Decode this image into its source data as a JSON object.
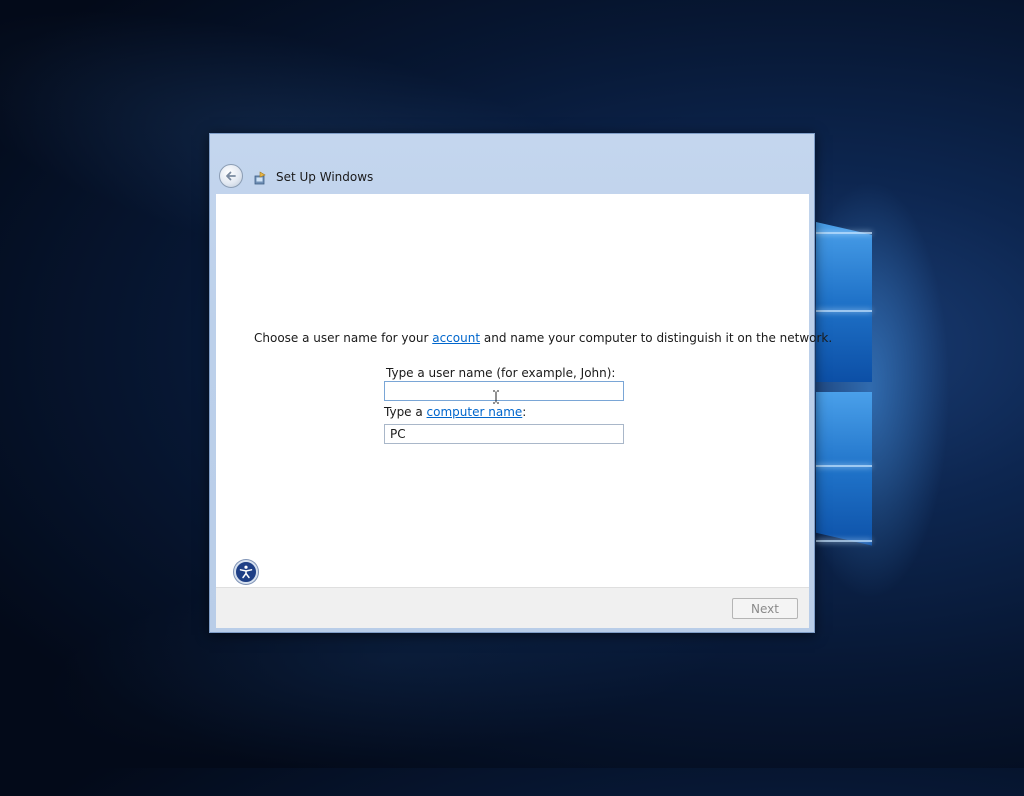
{
  "window": {
    "title": "Set Up Windows",
    "back_icon": "back-arrow-icon",
    "title_icon": "setup-icon"
  },
  "main": {
    "prompt_before": "Choose a user name for your ",
    "prompt_link": "account",
    "prompt_after": " and name your computer to distinguish it on the network.",
    "username_label": "Type a user name (for example, John):",
    "username_value": "",
    "computer_label_before": "Type a ",
    "computer_label_link": "computer name",
    "computer_label_after": ":",
    "computer_name_value": "PC"
  },
  "footer": {
    "ease_of_access_icon": "ease-of-access-icon",
    "next_label": "Next",
    "next_enabled": false
  },
  "colors": {
    "link": "#0066cc",
    "window_frame": "#bcd0ea",
    "desktop": "#071733"
  }
}
